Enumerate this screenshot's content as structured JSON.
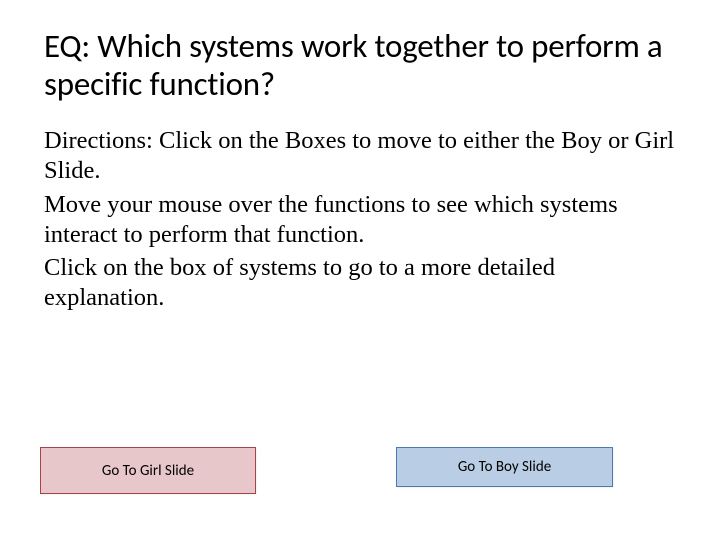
{
  "title": "EQ: Which systems work together to perform a specific function?",
  "directions": {
    "line1": "Directions:  Click on the Boxes to move to either the Boy or Girl Slide.",
    "line2": "Move your mouse over the functions to see which systems interact to perform that function.",
    "line3": "Click on the box of systems to go to a more detailed explanation."
  },
  "buttons": {
    "girl": "Go To Girl Slide",
    "boy": "Go To Boy Slide"
  }
}
